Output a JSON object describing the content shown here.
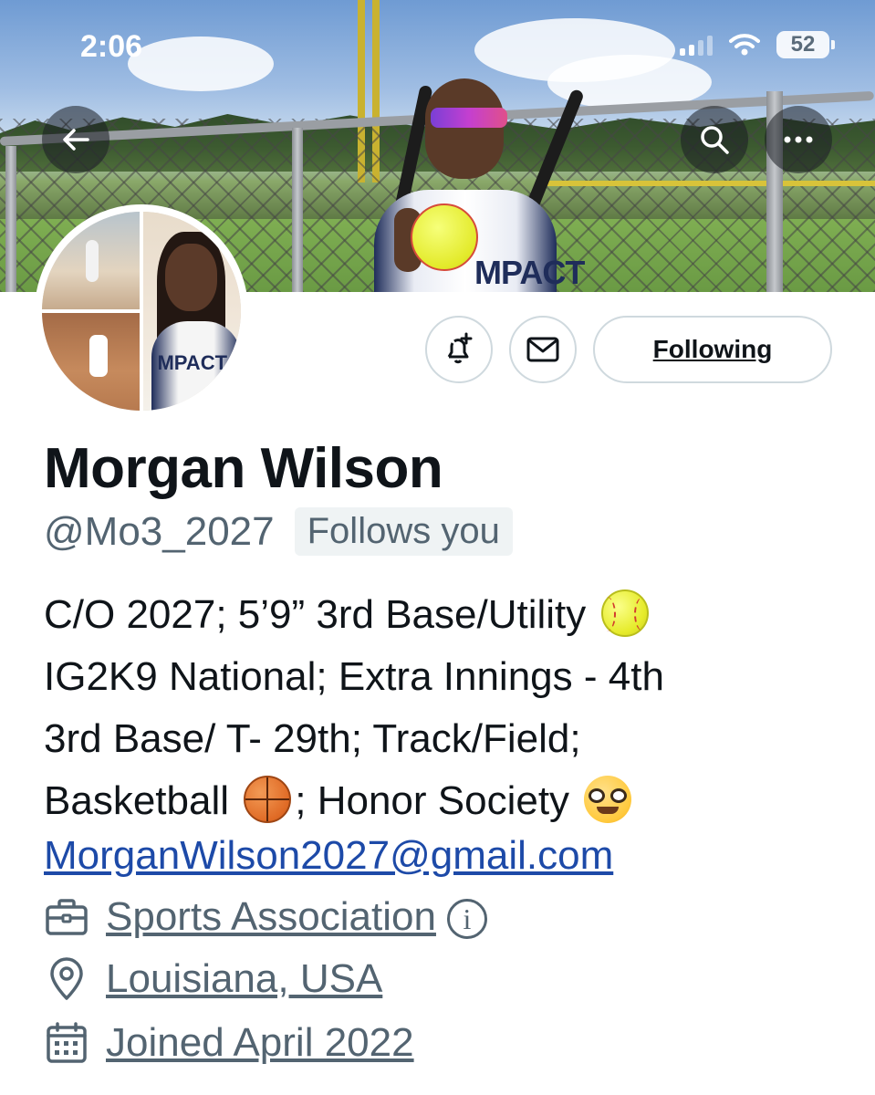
{
  "status_bar": {
    "time": "2:06",
    "battery": "52"
  },
  "header": {
    "back_icon": "arrow-left-icon",
    "search_icon": "search-icon",
    "more_icon": "more-horizontal-icon"
  },
  "banner": {
    "jersey_text": "MPACT"
  },
  "avatar": {
    "jersey_text": "MPACT"
  },
  "actions": {
    "notifications_icon": "bell-plus-icon",
    "message_icon": "envelope-icon",
    "follow_label": "Following"
  },
  "profile": {
    "name": "Morgan Wilson",
    "handle": "@Mo3_2027",
    "follows_you": "Follows you",
    "bio": {
      "line1": "C/O 2027; 5’9” 3rd Base/Utility",
      "line2": "IG2K9 National; Extra Innings - 4th",
      "line3": "3rd Base/ T- 29th; Track/Field;",
      "line4a": "Basketball",
      "line4b": "; Honor Society"
    },
    "email": "MorganWilson2027@gmail.com",
    "category": "Sports Association",
    "location": "Louisiana, USA",
    "joined": "Joined April 2022"
  },
  "colors": {
    "text_primary": "#0f1419",
    "text_secondary": "#536471",
    "link": "#1d4aa8",
    "border": "#cfd9de"
  }
}
